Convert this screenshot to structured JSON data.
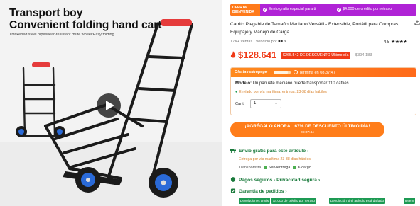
{
  "product_image": {
    "title_line1": "Transport boy",
    "title_line2": "Convenient folding hand cart",
    "subtitle": "Thickened steel pipe/wear-resistant mute wheel/Easy folding"
  },
  "promo_banner": {
    "badge": "OFERTA BIENVENIDA",
    "item1": "Envío gratis especial para ti",
    "item2": "$4.000 de crédito por retraso"
  },
  "product": {
    "title": "Carrito Plegable de Tamaño Mediano Versátil - Extensible, Portátil para Compras, Equipaje y Manejo de Carga",
    "sold": "17K+ ventas",
    "vendor_label": "Vendido por",
    "vendor_name": "■■ >",
    "rating_value": "4.5",
    "stars": "★★★★"
  },
  "price": {
    "current": "$128.641",
    "discount_badge": "$265.542 DE DESCUENTO Último día",
    "original": "$394.183"
  },
  "offer": {
    "label": "Oferta relámpago",
    "progress_fraction": 0.85,
    "timer_prefix": "Termina en",
    "timer": "08:37:47",
    "model_label": "Modelo:",
    "model_value": "Un paquete mediano puede transportar 110 catties",
    "shipping_estimate": "Envíado por vía marítima: entrega: 23-38 días hábiles",
    "qty_label": "Cant.",
    "qty_value": "1"
  },
  "cta": {
    "main": "¡AGRÉGALO AHORA! ¡67% DE DESCUENTO ÚLTIMO DÍA!",
    "sub": "08:37:44"
  },
  "shipping": {
    "title": "Envío gratis para este artículo",
    "estimate": "Entrega por vía marítima 23-38 días hábiles",
    "carrier_label": "Transportista",
    "carrier1": "Servientrega",
    "carrier2": "X-cargo ..."
  },
  "payment": {
    "title": "Pagos seguros - Privacidad segura"
  },
  "guarantee": {
    "title": "Garantía de pedidos",
    "chips": [
      "Devoluciones gratis",
      "$4.000 de crédito por retraso",
      "Devolución si el artículo está dañado",
      "Reem"
    ]
  },
  "colors": {
    "accent_orange": "#ff7d1a",
    "price_red": "#f03a17",
    "promo_purple": "#b023d6",
    "trust_green": "#1a7a3c"
  }
}
